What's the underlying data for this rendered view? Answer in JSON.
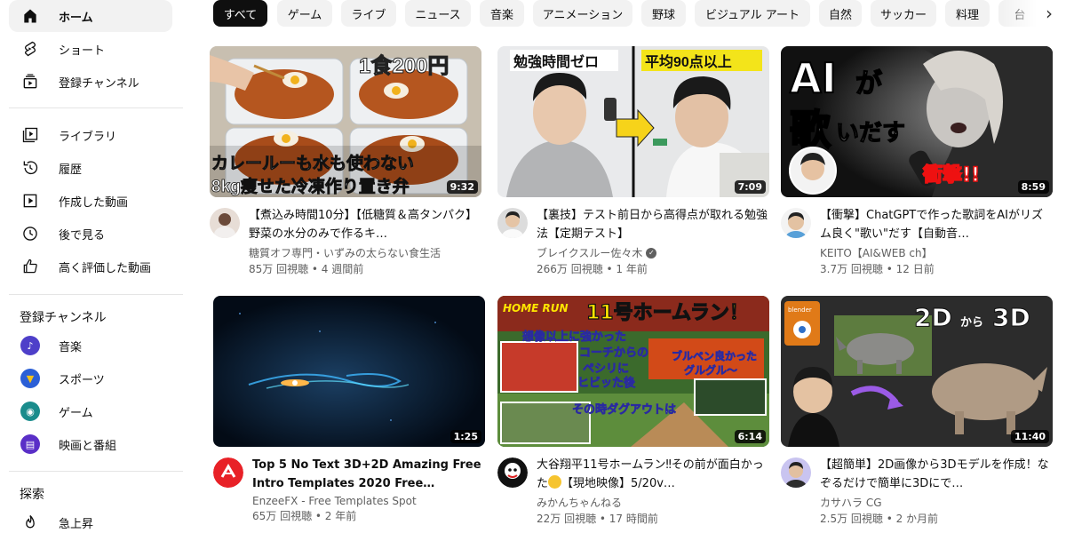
{
  "sidebar": {
    "main": [
      {
        "label": "ホーム",
        "icon": "home-icon"
      },
      {
        "label": "ショート",
        "icon": "shorts-icon"
      },
      {
        "label": "登録チャンネル",
        "icon": "subscriptions-icon"
      }
    ],
    "library": [
      {
        "label": "ライブラリ",
        "icon": "library-icon"
      },
      {
        "label": "履歴",
        "icon": "history-icon"
      },
      {
        "label": "作成した動画",
        "icon": "your-videos-icon"
      },
      {
        "label": "後で見る",
        "icon": "watch-later-icon"
      },
      {
        "label": "高く評価した動画",
        "icon": "liked-videos-icon"
      }
    ],
    "subscriptions_heading": "登録チャンネル",
    "subscriptions": [
      {
        "label": "音楽",
        "icon": "music-icon",
        "color": "#4e3fc9"
      },
      {
        "label": "スポーツ",
        "icon": "trophy-icon",
        "color": "#2b5fd6"
      },
      {
        "label": "ゲーム",
        "icon": "gaming-icon",
        "color": "#1a8c8c"
      },
      {
        "label": "映画と番組",
        "icon": "clapper-icon",
        "color": "#5a2fc7"
      }
    ],
    "explore_heading": "探索",
    "explore": [
      {
        "label": "急上昇",
        "icon": "trending-fire-icon"
      }
    ]
  },
  "chips": [
    "すべて",
    "ゲーム",
    "ライブ",
    "ニュース",
    "音楽",
    "アニメーション",
    "野球",
    "ビジュアル アート",
    "自然",
    "サッカー",
    "料理",
    "台"
  ],
  "videos": [
    {
      "title": "【煮込み時間10分】【低糖質＆高タンパク】野菜の水分のみで作るキ…",
      "channel": "糖質オフ専門・いずみの太らない食生活",
      "verified": false,
      "stats": "85万 回視聴 • 4 週間前",
      "duration": "9:32",
      "thumb_text": [
        "1食200円",
        "カレールーも水も使わない",
        "8kg痩せた冷凍作り置き弁"
      ]
    },
    {
      "title": "【裏技】テスト前日から高得点が取れる勉強法【定期テスト】",
      "channel": "ブレイクスルー佐々木",
      "verified": true,
      "stats": "266万 回視聴 • 1 年前",
      "duration": "7:09",
      "thumb_text": [
        "勉強時間ゼロ",
        "平均90点以上"
      ]
    },
    {
      "title": "【衝撃】ChatGPTで作った歌詞をAIがリズム良く\"歌い\"だす【自動音…",
      "channel": "KEITO【AI&WEB ch】",
      "verified": false,
      "stats": "3.7万 回視聴 • 12 日前",
      "duration": "8:59",
      "thumb_text": [
        "AI",
        "が",
        "歌",
        "いだす",
        "衝撃!!"
      ]
    },
    {
      "title": "Top 5 No Text 3D+2D Amazing Free Intro Templates 2020 Free…",
      "channel": "EnzeeFX - Free Templates Spot",
      "verified": false,
      "stats": "65万 回視聴 • 2 年前",
      "duration": "1:25",
      "thumb_text": []
    },
    {
      "title_before": "大谷翔平11号ホームラン‼その前が面白かった",
      "title_after": "【現地映像】5/20v…",
      "channel": "みかんちゃんねる",
      "verified": false,
      "stats": "22万 回視聴 • 17 時間前",
      "duration": "6:14",
      "thumb_text": [
        "HOME RUN",
        "11号ホームラン！",
        "想像以上に強かった",
        "コーチからの",
        "ペシリに",
        "ヒビッた後",
        "ブルペン良かった",
        "グルグル〜",
        "その時ダグアウトは"
      ]
    },
    {
      "title": "【超簡単】2D画像から3Dモデルを作成！なぞるだけで簡単に3Dにで…",
      "channel": "カサハラ CG",
      "verified": false,
      "stats": "2.5万 回視聴 • 2 か月前",
      "duration": "11:40",
      "thumb_text": [
        "blender",
        "2D",
        "から",
        "3D"
      ]
    }
  ],
  "icons": {
    "verified": "verified-check-icon",
    "chip_next": "chevron-right-icon"
  }
}
